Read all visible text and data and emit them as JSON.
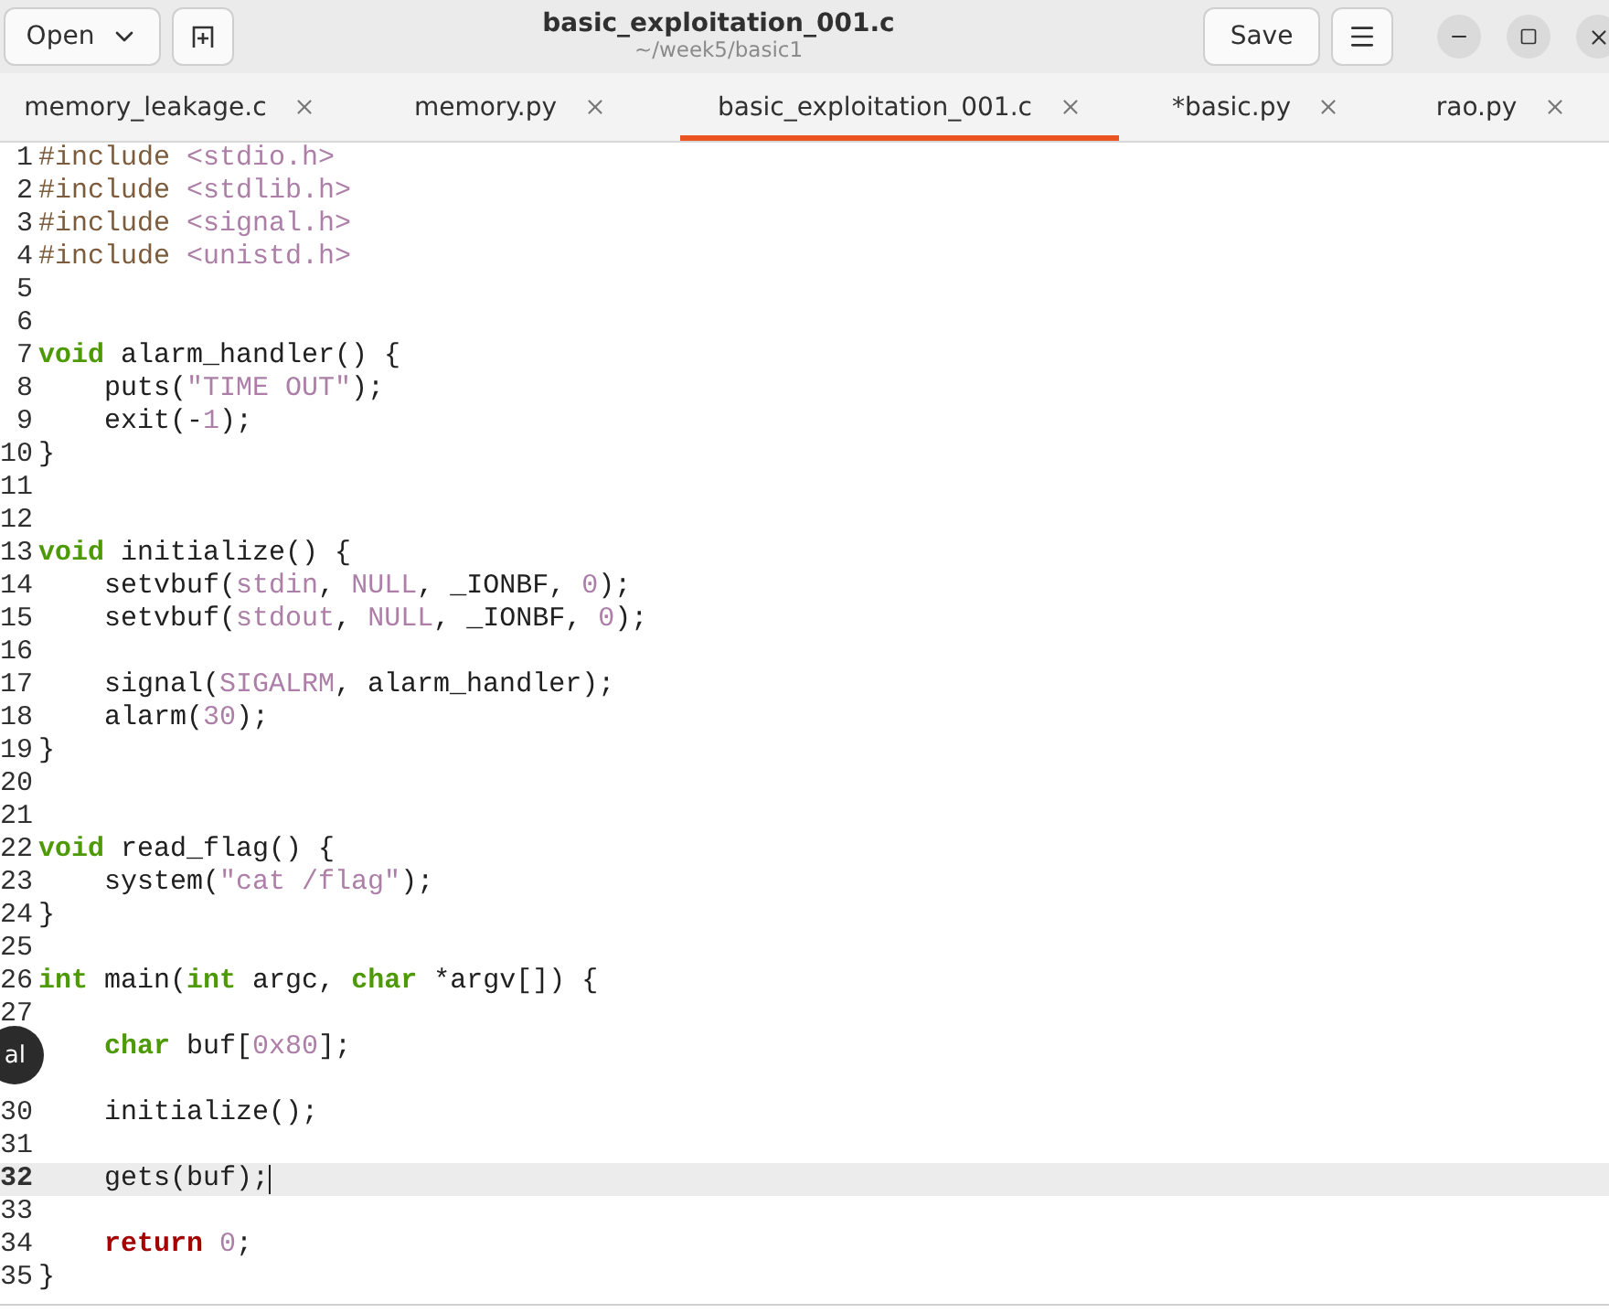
{
  "header": {
    "open_label": "Open",
    "title": "basic_exploitation_001.c",
    "subtitle": "~/week5/basic1",
    "save_label": "Save"
  },
  "tabs": [
    {
      "label": "memory_leakage.c",
      "selected": false
    },
    {
      "label": "memory.py",
      "selected": false
    },
    {
      "label": "basic_exploitation_001.c",
      "selected": true
    },
    {
      "label": "*basic.py",
      "selected": false
    },
    {
      "label": "rao.py",
      "selected": false
    }
  ],
  "tooltip": "al",
  "lines": [
    {
      "number": "1",
      "current": false,
      "tokens": [
        {
          "kind": "pre",
          "text": "#include "
        },
        {
          "kind": "str",
          "text": "<stdio.h>"
        }
      ]
    },
    {
      "number": "2",
      "current": false,
      "tokens": [
        {
          "kind": "pre",
          "text": "#include "
        },
        {
          "kind": "str",
          "text": "<stdlib.h>"
        }
      ]
    },
    {
      "number": "3",
      "current": false,
      "tokens": [
        {
          "kind": "pre",
          "text": "#include "
        },
        {
          "kind": "str",
          "text": "<signal.h>"
        }
      ]
    },
    {
      "number": "4",
      "current": false,
      "tokens": [
        {
          "kind": "pre",
          "text": "#include "
        },
        {
          "kind": "str",
          "text": "<unistd.h>"
        }
      ]
    },
    {
      "number": "5",
      "current": false
    },
    {
      "number": "6",
      "current": false
    },
    {
      "number": "7",
      "current": false,
      "tokens": [
        {
          "kind": "type",
          "text": "void"
        },
        {
          "kind": "plain",
          "text": " alarm_handler() {"
        }
      ]
    },
    {
      "number": "8",
      "current": false,
      "tokens": [
        {
          "kind": "plain",
          "text": "    puts("
        },
        {
          "kind": "str",
          "text": "\"TIME OUT\""
        },
        {
          "kind": "plain",
          "text": ");"
        }
      ]
    },
    {
      "number": "9",
      "current": false,
      "tokens": [
        {
          "kind": "plain",
          "text": "    exit(-"
        },
        {
          "kind": "str",
          "text": "1"
        },
        {
          "kind": "plain",
          "text": ");"
        }
      ]
    },
    {
      "number": "10",
      "current": false,
      "tokens": [
        {
          "kind": "plain",
          "text": "}"
        }
      ]
    },
    {
      "number": "11",
      "current": false
    },
    {
      "number": "12",
      "current": false
    },
    {
      "number": "13",
      "current": false,
      "tokens": [
        {
          "kind": "type",
          "text": "void"
        },
        {
          "kind": "plain",
          "text": " initialize() {"
        }
      ]
    },
    {
      "number": "14",
      "current": false,
      "tokens": [
        {
          "kind": "plain",
          "text": "    setvbuf("
        },
        {
          "kind": "str",
          "text": "stdin"
        },
        {
          "kind": "plain",
          "text": ", "
        },
        {
          "kind": "str",
          "text": "NULL"
        },
        {
          "kind": "plain",
          "text": ", _IONBF, "
        },
        {
          "kind": "str",
          "text": "0"
        },
        {
          "kind": "plain",
          "text": ");"
        }
      ]
    },
    {
      "number": "15",
      "current": false,
      "tokens": [
        {
          "kind": "plain",
          "text": "    setvbuf("
        },
        {
          "kind": "str",
          "text": "stdout"
        },
        {
          "kind": "plain",
          "text": ", "
        },
        {
          "kind": "str",
          "text": "NULL"
        },
        {
          "kind": "plain",
          "text": ", _IONBF, "
        },
        {
          "kind": "str",
          "text": "0"
        },
        {
          "kind": "plain",
          "text": ");"
        }
      ]
    },
    {
      "number": "16",
      "current": false
    },
    {
      "number": "17",
      "current": false,
      "tokens": [
        {
          "kind": "plain",
          "text": "    signal("
        },
        {
          "kind": "str",
          "text": "SIGALRM"
        },
        {
          "kind": "plain",
          "text": ", alarm_handler);"
        }
      ]
    },
    {
      "number": "18",
      "current": false,
      "tokens": [
        {
          "kind": "plain",
          "text": "    alarm("
        },
        {
          "kind": "str",
          "text": "30"
        },
        {
          "kind": "plain",
          "text": ");"
        }
      ]
    },
    {
      "number": "19",
      "current": false,
      "tokens": [
        {
          "kind": "plain",
          "text": "}"
        }
      ]
    },
    {
      "number": "20",
      "current": false
    },
    {
      "number": "21",
      "current": false
    },
    {
      "number": "22",
      "current": false,
      "tokens": [
        {
          "kind": "type",
          "text": "void"
        },
        {
          "kind": "plain",
          "text": " read_flag() {"
        }
      ]
    },
    {
      "number": "23",
      "current": false,
      "tokens": [
        {
          "kind": "plain",
          "text": "    system("
        },
        {
          "kind": "str",
          "text": "\"cat /flag\""
        },
        {
          "kind": "plain",
          "text": ");"
        }
      ]
    },
    {
      "number": "24",
      "current": false,
      "tokens": [
        {
          "kind": "plain",
          "text": "}"
        }
      ]
    },
    {
      "number": "25",
      "current": false
    },
    {
      "number": "26",
      "current": false,
      "tokens": [
        {
          "kind": "type",
          "text": "int"
        },
        {
          "kind": "plain",
          "text": " main("
        },
        {
          "kind": "type",
          "text": "int"
        },
        {
          "kind": "plain",
          "text": " argc, "
        },
        {
          "kind": "type",
          "text": "char"
        },
        {
          "kind": "plain",
          "text": " *argv[]) {"
        }
      ]
    },
    {
      "number": "27",
      "current": false
    },
    {
      "current": false,
      "tokens": [
        {
          "kind": "type",
          "text": "    char"
        },
        {
          "kind": "plain",
          "text": " buf["
        },
        {
          "kind": "str",
          "text": "0x80"
        },
        {
          "kind": "plain",
          "text": "];"
        }
      ]
    },
    {
      "current": false
    },
    {
      "number": "30",
      "current": false,
      "tokens": [
        {
          "kind": "plain",
          "text": "    initialize();"
        }
      ]
    },
    {
      "number": "31",
      "current": false
    },
    {
      "number": "32",
      "current": true,
      "tokens": [
        {
          "kind": "plain",
          "text": "    gets(buf);"
        }
      ]
    },
    {
      "number": "33",
      "current": false
    },
    {
      "number": "34",
      "current": false,
      "tokens": [
        {
          "kind": "ret",
          "text": "    return"
        },
        {
          "kind": "str",
          "text": " 0"
        },
        {
          "kind": "plain",
          "text": ";"
        }
      ]
    },
    {
      "number": "35",
      "current": false,
      "tokens": [
        {
          "kind": "plain",
          "text": "}"
        }
      ]
    }
  ]
}
